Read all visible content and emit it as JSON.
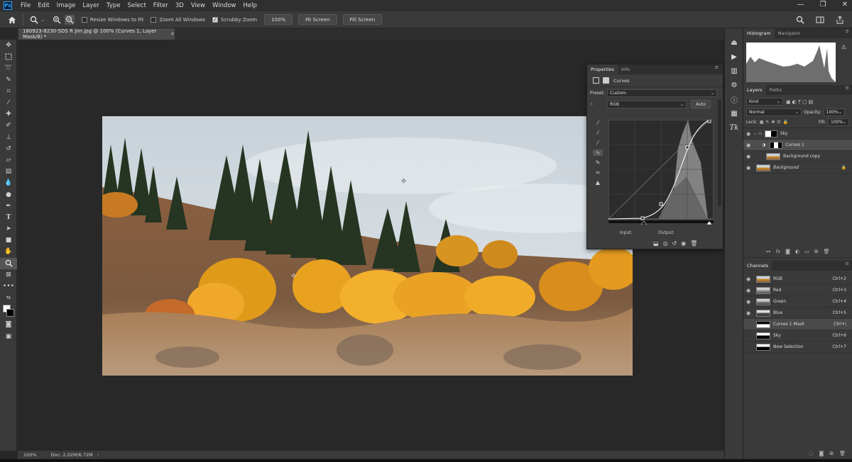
{
  "colors": {
    "accent": "#31a8ff",
    "app_bg": "#282828",
    "panel_bg": "#3a3a3a"
  },
  "app": {
    "logo": "Ps"
  },
  "menu": [
    "File",
    "Edit",
    "Image",
    "Layer",
    "Type",
    "Select",
    "Filter",
    "3D",
    "View",
    "Window",
    "Help"
  ],
  "window_controls": [
    "—",
    "❐",
    "✕"
  ],
  "options_bar": {
    "resize_windows": "Resize Windows to Fit",
    "zoom_all_windows": "Zoom All Windows",
    "scrubby_zoom": "Scrubby Zoom",
    "zoom_100": "100%",
    "fit_screen": "Fit Screen",
    "fill_screen": "Fill Screen"
  },
  "document": {
    "tab_title": "180923-8230-5DS R Jim.jpg @ 100% (Curves 1, Layer Mask/8) *",
    "close": "✕"
  },
  "status": {
    "zoom": "100%",
    "doc": "Doc: 2.02M/6.72M"
  },
  "properties": {
    "tabs": [
      "Properties",
      "Info"
    ],
    "adjustment": "Curves",
    "preset_label": "Preset:",
    "preset_value": "Custom",
    "channel_value": "RGB",
    "auto": "Auto",
    "input_label": "Input:",
    "output_label": "Output:"
  },
  "histogram_panel": {
    "tabs": [
      "Histogram",
      "Navigator"
    ]
  },
  "layers_panel": {
    "tabs": [
      "Layers",
      "Paths"
    ],
    "filter": "Kind",
    "blend_mode": "Normal",
    "opacity_label": "Opacity:",
    "opacity_value": "100%",
    "lock_label": "Lock:",
    "fill_label": "Fill:",
    "fill_value": "100%",
    "layers": [
      {
        "name": "Sky",
        "type": "group"
      },
      {
        "name": "Curves 1",
        "type": "adjustment"
      },
      {
        "name": "Background copy",
        "type": "image"
      },
      {
        "name": "Background",
        "type": "image"
      }
    ]
  },
  "channels_panel": {
    "tabs": [
      "Channels"
    ],
    "channels": [
      {
        "name": "RGB",
        "shortcut": "Ctrl+2"
      },
      {
        "name": "Red",
        "shortcut": "Ctrl+3"
      },
      {
        "name": "Green",
        "shortcut": "Ctrl+4"
      },
      {
        "name": "Blue",
        "shortcut": "Ctrl+5"
      },
      {
        "name": "Curves 1 Mask",
        "shortcut": "Ctrl+\\"
      },
      {
        "name": "Sky",
        "shortcut": "Ctrl+6"
      },
      {
        "name": "New Selection",
        "shortcut": "Ctrl+7"
      }
    ]
  }
}
